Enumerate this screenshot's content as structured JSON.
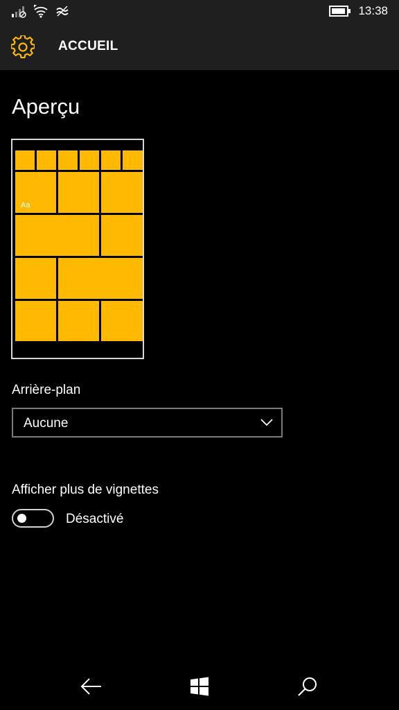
{
  "status_bar": {
    "time": "13:38",
    "icons": [
      "signal-icon",
      "wifi-icon",
      "data-saver-icon",
      "battery-icon"
    ]
  },
  "header": {
    "title": "ACCUEIL",
    "icon": "gear-icon"
  },
  "preview": {
    "title": "Aperçu",
    "tile_label": "Aa",
    "tile_color": "#ffb900"
  },
  "background": {
    "label": "Arrière-plan",
    "selected": "Aucune"
  },
  "more_tiles": {
    "label": "Afficher plus de vignettes",
    "state": "Désactivé",
    "value": false
  },
  "nav": {
    "icons": [
      "back-arrow-icon",
      "windows-start-icon",
      "search-icon"
    ]
  },
  "colors": {
    "accent": "#ffb900",
    "background": "#000000",
    "header_bg": "#1f1f1f"
  }
}
